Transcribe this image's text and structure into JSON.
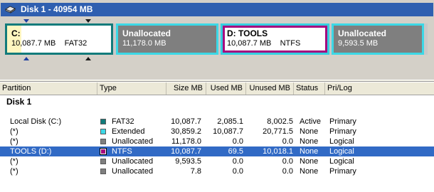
{
  "disk": {
    "title": "Disk 1 - 40954 MB",
    "icon": "disk-icon"
  },
  "map": {
    "partitions": [
      {
        "name": "C:",
        "size": "10,087.7 MB",
        "fs": "FAT32"
      },
      {
        "name": "Unallocated",
        "size": "11,178.0 MB",
        "fs": ""
      },
      {
        "name": "D:  TOOLS",
        "size": "10,087.7 MB",
        "fs": "NTFS"
      },
      {
        "name": "Unallocated",
        "size": "9,593.5 MB",
        "fs": ""
      }
    ],
    "colors": {
      "fat32": "#127b7b",
      "extended": "#3cd8e6",
      "ntfs": "#a5087e",
      "unallocated": "#7f7f7f"
    }
  },
  "columns": [
    "Partition",
    "Type",
    "Size MB",
    "Used MB",
    "Unused MB",
    "Status",
    "Pri/Log"
  ],
  "group": "Disk 1",
  "rows": [
    {
      "partition": "Local Disk (C:)",
      "type": "FAT32",
      "size": "10,087.7",
      "used": "2,085.1",
      "unused": "8,002.5",
      "status": "Active",
      "prilog": "Primary",
      "color": "#127b7b"
    },
    {
      "partition": "(*)",
      "type": "Extended",
      "size": "30,859.2",
      "used": "10,087.7",
      "unused": "20,771.5",
      "status": "None",
      "prilog": "Primary",
      "color": "#3cd8e6"
    },
    {
      "partition": "(*)",
      "type": "Unallocated",
      "size": "11,178.0",
      "used": "0.0",
      "unused": "0.0",
      "status": "None",
      "prilog": "Logical",
      "color": "#7f7f7f"
    },
    {
      "partition": "TOOLS (D:)",
      "type": "NTFS",
      "size": "10,087.7",
      "used": "69.5",
      "unused": "10,018.1",
      "status": "None",
      "prilog": "Logical",
      "color": "#a5087e",
      "selected": true
    },
    {
      "partition": "(*)",
      "type": "Unallocated",
      "size": "9,593.5",
      "used": "0.0",
      "unused": "0.0",
      "status": "None",
      "prilog": "Logical",
      "color": "#7f7f7f"
    },
    {
      "partition": "(*)",
      "type": "Unallocated",
      "size": "7.8",
      "used": "0.0",
      "unused": "0.0",
      "status": "None",
      "prilog": "Primary",
      "color": "#7f7f7f"
    }
  ]
}
